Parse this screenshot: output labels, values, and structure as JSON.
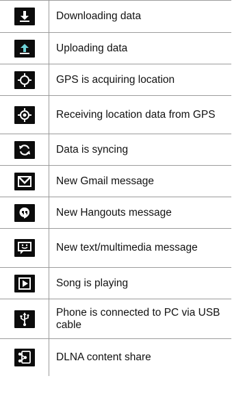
{
  "rows": [
    {
      "icon": "download-icon",
      "label": "Downloading data"
    },
    {
      "icon": "upload-icon",
      "label": "Uploading data"
    },
    {
      "icon": "gps-acquiring-icon",
      "label": "GPS is acquiring location"
    },
    {
      "icon": "gps-receiving-icon",
      "label": "Receiving location data from GPS"
    },
    {
      "icon": "sync-icon",
      "label": "Data is syncing"
    },
    {
      "icon": "gmail-icon",
      "label": "New Gmail message"
    },
    {
      "icon": "hangouts-icon",
      "label": "New Hangouts message"
    },
    {
      "icon": "messaging-icon",
      "label": "New text/multimedia message"
    },
    {
      "icon": "play-icon",
      "label": "Song is playing"
    },
    {
      "icon": "usb-icon",
      "label": "Phone is connected to PC via USB cable"
    },
    {
      "icon": "dlna-share-icon",
      "label": "DLNA content share"
    }
  ],
  "colors": {
    "icon_bg": "#0c0c0c",
    "upload_accent": "#6fd3d8",
    "border": "#9a9a9a"
  }
}
